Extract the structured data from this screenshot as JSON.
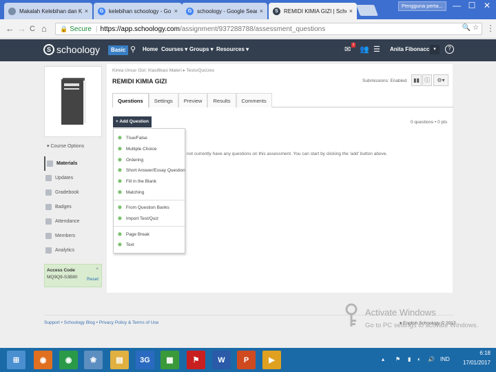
{
  "browser": {
    "tabs": [
      {
        "label": "Makalah Kelebihan dan K",
        "favicon_color": "#7a8ea8",
        "favicon_glyph": "",
        "active": false
      },
      {
        "label": "kelebihan schoology - Go",
        "favicon_color": "#4285f4",
        "favicon_glyph": "G",
        "active": false
      },
      {
        "label": "schoology - Google Sear",
        "favicon_color": "#4285f4",
        "favicon_glyph": "G",
        "active": false
      },
      {
        "label": "REMIDI KIMIA GIZI | Scho",
        "favicon_color": "#333f4f",
        "favicon_glyph": "S",
        "active": true
      }
    ],
    "close_glyph": "×",
    "user_badge": "Pengguna perta...",
    "window_controls": {
      "minimize": "—",
      "maximize": "☐",
      "close": "✕"
    },
    "nav": {
      "back": "←",
      "forward": "→",
      "reload": "C",
      "home": "⌂"
    },
    "secure_label": "Secure",
    "url_host": "https://app.schoology.com",
    "url_path": "/assignment/937288788/assessment_questions",
    "omni_icons": "🔍 ☆",
    "menu_dots": "⋮"
  },
  "header": {
    "logo_text": "schoology",
    "logo_letter": "S",
    "basic_label": "Basic",
    "search_glyph": "⚲",
    "nav": [
      {
        "label": "Home"
      },
      {
        "label": "Courses ▾"
      },
      {
        "label": "Groups ▾"
      },
      {
        "label": "Resources ▾"
      }
    ],
    "notification_count": "1",
    "user_name": "Anita Fibonacci",
    "caret": "▾",
    "help": "?"
  },
  "sidebar": {
    "course_options": "▾ Course Options",
    "items": [
      {
        "label": "Materials",
        "active": true
      },
      {
        "label": "Updates"
      },
      {
        "label": "Gradebook"
      },
      {
        "label": "Badges"
      },
      {
        "label": "Attendance"
      },
      {
        "label": "Members"
      },
      {
        "label": "Analytics"
      }
    ],
    "access_code": {
      "title": "Access Code",
      "value": "MQ9Q9-S3B80",
      "reset": "Reset",
      "close": "×"
    }
  },
  "main": {
    "breadcrumb": "Kimia Unsur Gizi: Klasifikasi Materi ▸ Tests/Quizzes",
    "title": "REMIDI KIMIA GIZI",
    "submission_status": "Submissions: Enabled",
    "tool_icons": [
      "▮▮",
      "ⓘ",
      "⚙▾"
    ],
    "tabs": [
      {
        "label": "Questions",
        "active": true
      },
      {
        "label": "Settings"
      },
      {
        "label": "Preview"
      },
      {
        "label": "Results"
      },
      {
        "label": "Comments"
      }
    ],
    "add_question": "+ Add Question",
    "question_count": "0 questions • 0 pts",
    "empty_message": "do not currently have any questions on this assessment. You can start by clicking the 'add' button above.",
    "dropdown": {
      "group1": [
        "True/False",
        "Multiple Choice",
        "Ordering",
        "Short Answer/Essay Question",
        "Fill in the Blank",
        "Matching"
      ],
      "group2": [
        "From Question Banks",
        "Import Test/Quiz"
      ],
      "group3": [
        "Page Break",
        "Text"
      ],
      "plus": "⊕"
    }
  },
  "footer": {
    "links": "Support • Schoology Blog • Privacy Policy & Terms of Use",
    "language": "▾ English  Schoology © 2017"
  },
  "watermark": {
    "title": "Activate Windows",
    "subtitle": "Go to PC settings to activate Windows."
  },
  "taskbar": {
    "apps": [
      {
        "name": "start-icon",
        "color": "#4a8fd0",
        "glyph": "⊞"
      },
      {
        "name": "firefox-icon",
        "color": "#e07020",
        "glyph": "◉"
      },
      {
        "name": "chrome-icon",
        "color": "#2a9a48",
        "glyph": "◉"
      },
      {
        "name": "app-icon",
        "color": "#5c8fc0",
        "glyph": "❀"
      },
      {
        "name": "folder-icon",
        "color": "#e0b040",
        "glyph": "▤"
      },
      {
        "name": "3g-icon",
        "color": "#2a6ac0",
        "glyph": "3G"
      },
      {
        "name": "apps-grid-icon",
        "color": "#3a9a3a",
        "glyph": "▦"
      },
      {
        "name": "acrobat-icon",
        "color": "#c82020",
        "glyph": "⚑"
      },
      {
        "name": "word-icon",
        "color": "#2a5aa8",
        "glyph": "W"
      },
      {
        "name": "powerpoint-icon",
        "color": "#d04a20",
        "glyph": "P"
      },
      {
        "name": "media-icon",
        "color": "#e0a020",
        "glyph": "▶"
      }
    ],
    "tray": [
      "▴",
      "⚑",
      "▮",
      "◐",
      "🔊"
    ],
    "lang": "IND",
    "time": "6:18",
    "date": "17/01/2017"
  },
  "colors": {
    "header_bg": "#333f4f",
    "accent_blue": "#3a7fc4",
    "access_green": "#d9ecd0",
    "taskbar": "#1b6aa8"
  }
}
